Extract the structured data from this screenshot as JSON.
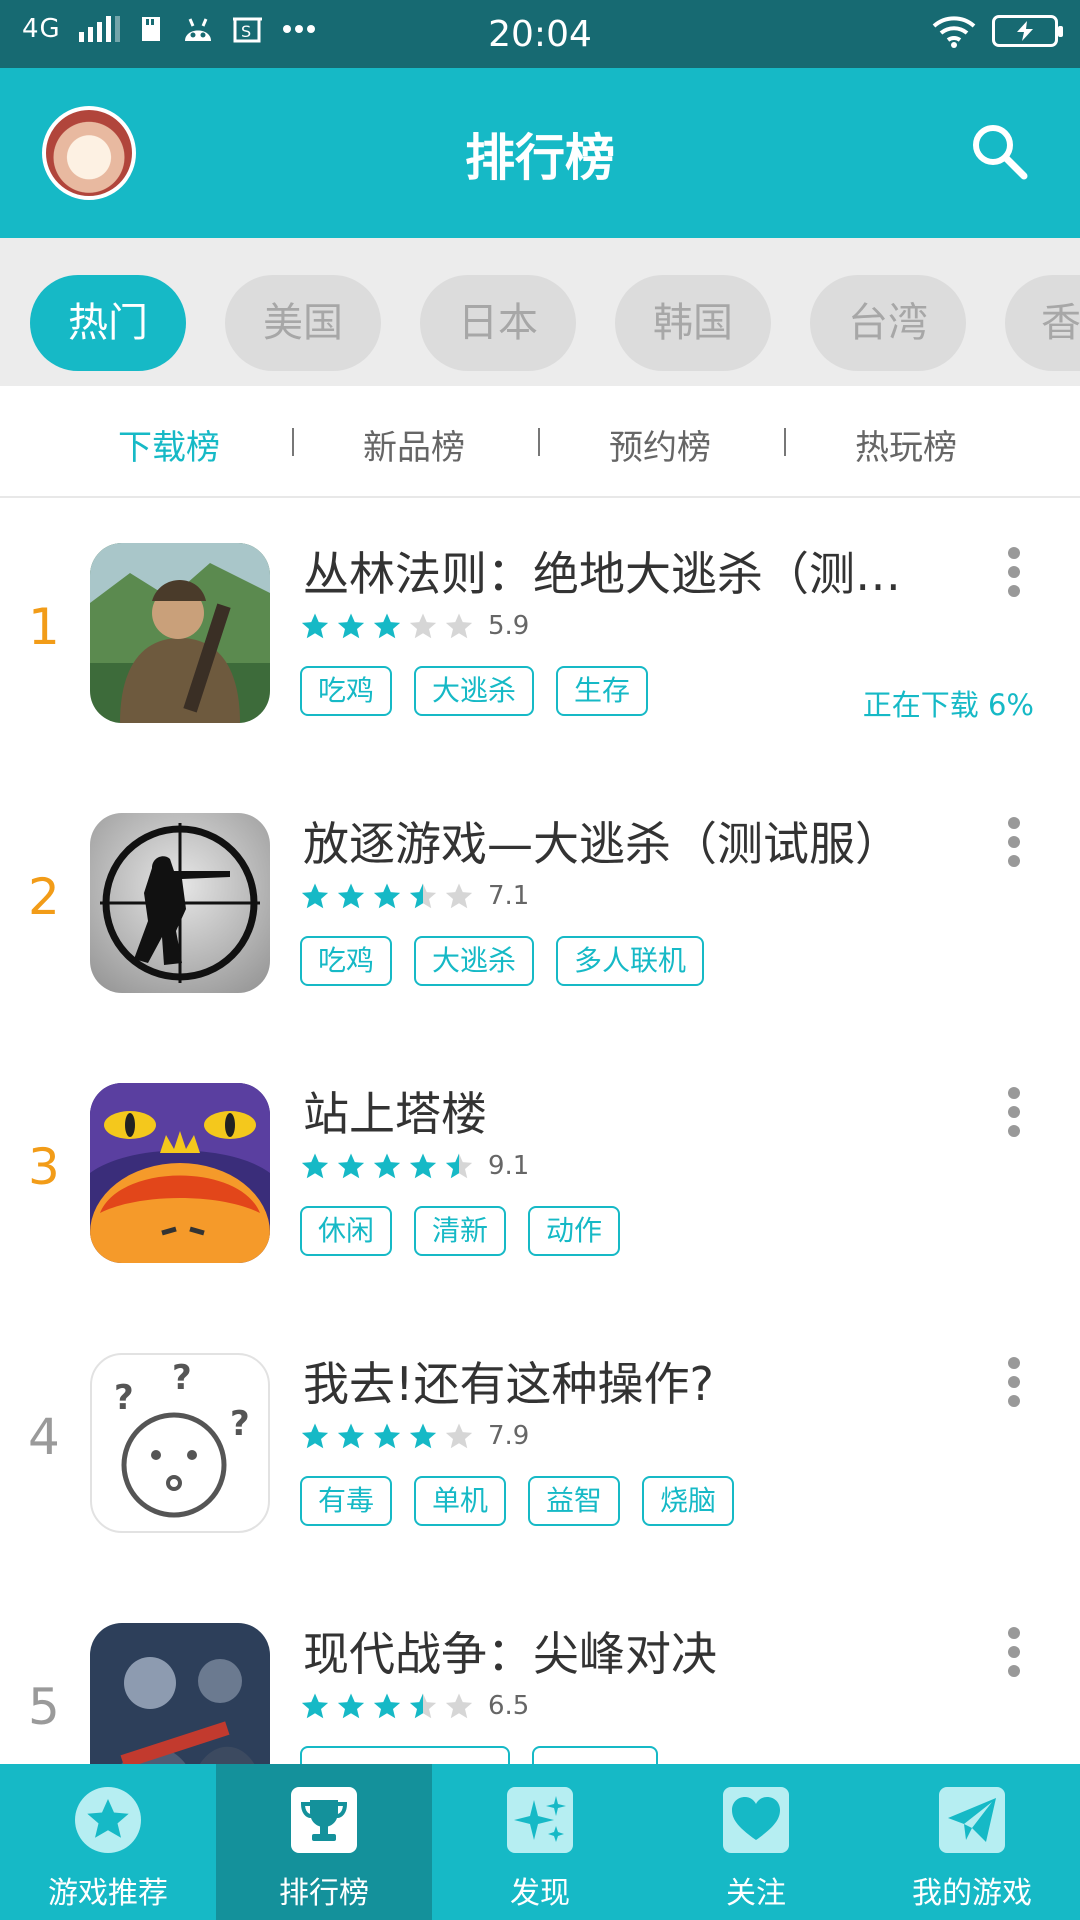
{
  "status_bar": {
    "network": "4G",
    "time": "20:04"
  },
  "header": {
    "title": "排行榜"
  },
  "regions": [
    "热门",
    "美国",
    "日本",
    "韩国",
    "台湾",
    "香"
  ],
  "subtabs": [
    "下载榜",
    "新品榜",
    "预约榜",
    "热玩榜"
  ],
  "games": [
    {
      "rank": "1",
      "name": "丛林法则：绝地大逃杀（测…",
      "rating": 3,
      "score": "5.9",
      "tags": [
        "吃鸡",
        "大逃杀",
        "生存"
      ],
      "status": "正在下载 6%"
    },
    {
      "rank": "2",
      "name": "放逐游戏—大逃杀（测试服）",
      "rating": 3.5,
      "score": "7.1",
      "tags": [
        "吃鸡",
        "大逃杀",
        "多人联机"
      ]
    },
    {
      "rank": "3",
      "name": "站上塔楼",
      "rating": 4.5,
      "score": "9.1",
      "tags": [
        "休闲",
        "清新",
        "动作"
      ]
    },
    {
      "rank": "4",
      "name": "我去!还有这种操作?",
      "rating": 4,
      "score": "7.9",
      "tags": [
        "有毒",
        "单机",
        "益智",
        "烧脑"
      ]
    },
    {
      "rank": "5",
      "name": "现代战争：尖峰对决",
      "rating": 3.5,
      "score": "6.5",
      "tags": [
        "",
        ""
      ]
    }
  ],
  "bottom_nav": [
    {
      "label": "游戏推荐",
      "icon": "star-icon"
    },
    {
      "label": "排行榜",
      "icon": "trophy-icon"
    },
    {
      "label": "发现",
      "icon": "sparkle-icon"
    },
    {
      "label": "关注",
      "icon": "heart-icon"
    },
    {
      "label": "我的游戏",
      "icon": "paper-plane-icon"
    }
  ],
  "colors": {
    "accent": "#16b9c6",
    "rank_top": "#f29c18",
    "statusbar": "#176a72"
  }
}
